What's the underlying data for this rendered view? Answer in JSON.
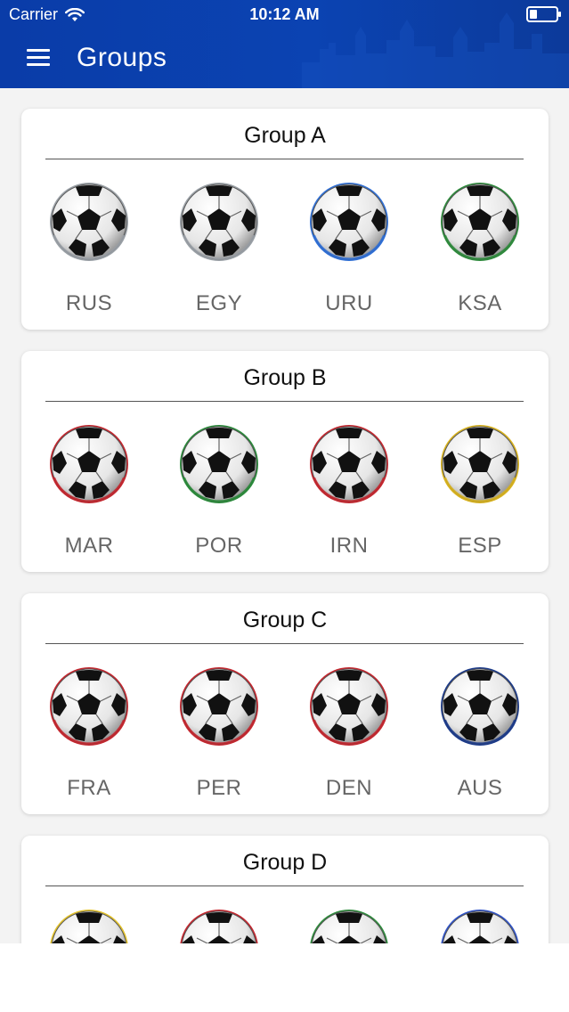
{
  "status_bar": {
    "carrier": "Carrier",
    "time": "10:12 AM",
    "battery_level": 0.3
  },
  "nav": {
    "title": "Groups",
    "menu_icon": "menu-icon"
  },
  "groups": [
    {
      "title": "Group A",
      "teams": [
        {
          "code": "RUS",
          "accent": "#9aa0a6"
        },
        {
          "code": "EGY",
          "accent": "#9aa0a6"
        },
        {
          "code": "URU",
          "accent": "#2f6fd6"
        },
        {
          "code": "KSA",
          "accent": "#2e8b3c"
        }
      ]
    },
    {
      "title": "Group B",
      "teams": [
        {
          "code": "MAR",
          "accent": "#c4262e"
        },
        {
          "code": "POR",
          "accent": "#2a8a3a"
        },
        {
          "code": "IRN",
          "accent": "#c4262e"
        },
        {
          "code": "ESP",
          "accent": "#d8b21d"
        }
      ]
    },
    {
      "title": "Group C",
      "teams": [
        {
          "code": "FRA",
          "accent": "#c4262e"
        },
        {
          "code": "PER",
          "accent": "#c4262e"
        },
        {
          "code": "DEN",
          "accent": "#c4262e"
        },
        {
          "code": "AUS",
          "accent": "#1b3a8a"
        }
      ]
    },
    {
      "title": "Group D",
      "teams": [
        {
          "code": "",
          "accent": "#e2c12a"
        },
        {
          "code": "",
          "accent": "#c4262e"
        },
        {
          "code": "",
          "accent": "#2e8b3c"
        },
        {
          "code": "",
          "accent": "#2f52c6"
        }
      ]
    }
  ]
}
